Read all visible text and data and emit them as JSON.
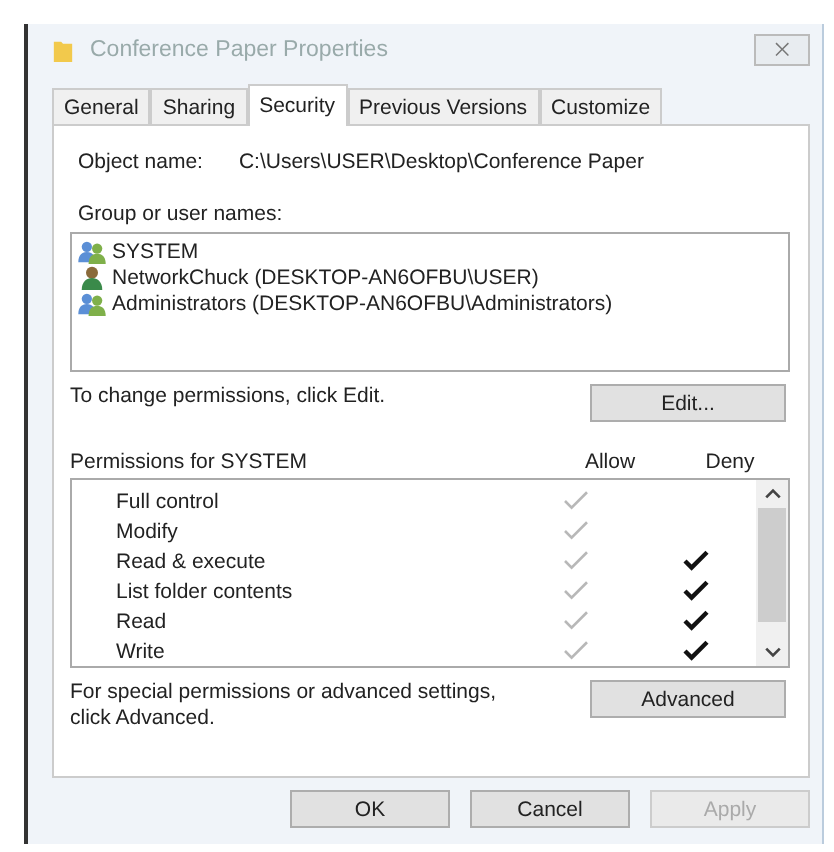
{
  "window": {
    "title": "Conference Paper Properties",
    "close": "⨉"
  },
  "tabs": [
    {
      "label": "General",
      "selected": false
    },
    {
      "label": "Sharing",
      "selected": false
    },
    {
      "label": "Security",
      "selected": true
    },
    {
      "label": "Previous Versions",
      "selected": false
    },
    {
      "label": "Customize",
      "selected": false
    }
  ],
  "object_name": {
    "label": "Object name:",
    "value": "C:\\Users\\USER\\Desktop\\Conference Paper"
  },
  "groups": {
    "label": "Group or user names:",
    "items": [
      {
        "name": "SYSTEM",
        "kind": "group"
      },
      {
        "name": "NetworkChuck (DESKTOP-AN6OFBU\\USER)",
        "kind": "user"
      },
      {
        "name": "Administrators (DESKTOP-AN6OFBU\\Administrators)",
        "kind": "group"
      }
    ]
  },
  "edit_hint": "To change permissions, click Edit.",
  "edit_button": "Edit...",
  "permissions": {
    "label": "Permissions for SYSTEM",
    "allow_label": "Allow",
    "deny_label": "Deny",
    "rows": [
      {
        "name": "Full control",
        "allow": true,
        "deny": false
      },
      {
        "name": "Modify",
        "allow": true,
        "deny": false
      },
      {
        "name": "Read & execute",
        "allow": true,
        "deny": true
      },
      {
        "name": "List folder contents",
        "allow": true,
        "deny": true
      },
      {
        "name": "Read",
        "allow": true,
        "deny": true
      },
      {
        "name": "Write",
        "allow": true,
        "deny": true
      }
    ]
  },
  "advanced_hint": "For special permissions or advanced settings, click Advanced.",
  "advanced_button": "Advanced",
  "buttons": [
    {
      "label": "OK",
      "disabled": false
    },
    {
      "label": "Cancel",
      "disabled": false
    },
    {
      "label": "Apply",
      "disabled": true
    }
  ]
}
